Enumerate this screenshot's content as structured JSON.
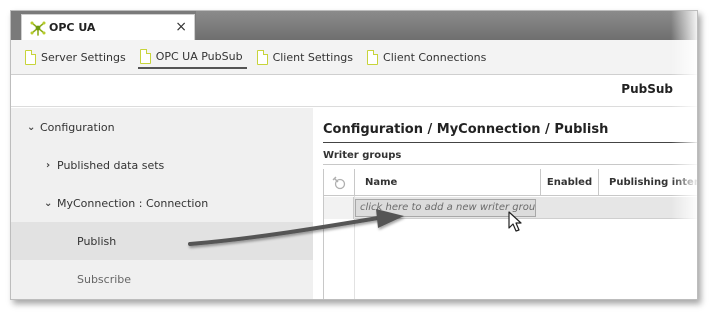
{
  "app_tab": {
    "title": "OPC UA",
    "close": "×",
    "icon": "opc-ua-logo-icon"
  },
  "subtabs": [
    {
      "label": "Server Settings",
      "icon": "document-icon",
      "active": false
    },
    {
      "label": "OPC UA PubSub",
      "icon": "document-icon",
      "active": true
    },
    {
      "label": "Client Settings",
      "icon": "document-icon",
      "active": false
    },
    {
      "label": "Client Connections",
      "icon": "document-icon",
      "active": false
    }
  ],
  "page_title": "PubSub",
  "tree": {
    "nodes": [
      {
        "label": "Configuration",
        "chevron": "⌄",
        "expanded": true
      },
      {
        "label": "Published data sets",
        "chevron": "›",
        "expanded": false
      },
      {
        "label": "MyConnection : Connection",
        "chevron": "⌄",
        "expanded": true
      },
      {
        "label": "Publish",
        "selected": true
      },
      {
        "label": "Subscribe",
        "selected": false
      }
    ]
  },
  "content": {
    "breadcrumb": "Configuration / MyConnection / Publish",
    "section_title": "Writer groups",
    "columns": {
      "icon": "pin-icon",
      "name": "Name",
      "enabled": "Enabled",
      "interval": "Publishing interval"
    },
    "new_row_placeholder": "click here to add a new writer group"
  },
  "colors": {
    "accent": "#c7d43a",
    "tab_bar": "#7a7a7a",
    "tree_bg": "#f0f0f0",
    "arrow": "#555555"
  }
}
